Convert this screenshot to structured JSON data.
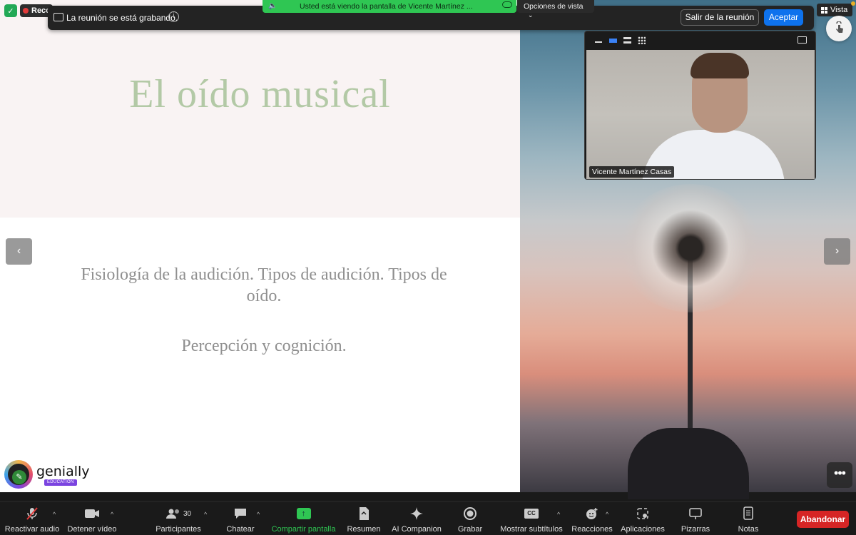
{
  "status": {
    "recording_label": "Recc",
    "recording_notice": "La reunión se está grabando.",
    "sharing_banner": "Usted está viendo la pantalla de Vicente Martínez ...",
    "view_options": "Opciones de vista",
    "leave_button": "Salir de la reunión",
    "accept_button": "Aceptar",
    "view_button": "Vista"
  },
  "slide": {
    "title": "El oído musical",
    "subtitle_1": "Fisiología de la audición. Tipos de audición. Tipos de oído.",
    "subtitle_2": "Percepción y cognición.",
    "brand": "genially",
    "brand_tag": "EDUCATION"
  },
  "video": {
    "participant_name": "Vicente Martínez Casas"
  },
  "toolbar": {
    "items": [
      {
        "label": "Reactivar audio",
        "icon": "mic-muted-icon"
      },
      {
        "label": "Detener vídeo",
        "icon": "video-camera-icon"
      },
      {
        "label": "Participantes",
        "icon": "participants-icon",
        "count": "30"
      },
      {
        "label": "Chatear",
        "icon": "chat-icon"
      },
      {
        "label": "Compartir pantalla",
        "icon": "share-screen-icon"
      },
      {
        "label": "Resumen",
        "icon": "summary-icon"
      },
      {
        "label": "AI Companion",
        "icon": "sparkle-icon"
      },
      {
        "label": "Grabar",
        "icon": "record-icon"
      },
      {
        "label": "Mostrar subtítulos",
        "icon": "captions-icon"
      },
      {
        "label": "Reacciones",
        "icon": "reactions-icon"
      },
      {
        "label": "Aplicaciones",
        "icon": "apps-icon"
      },
      {
        "label": "Pizarras",
        "icon": "whiteboard-icon"
      },
      {
        "label": "Notas",
        "icon": "notes-icon"
      }
    ],
    "end_button": "Abandonar"
  },
  "colors": {
    "share_green": "#2fc653",
    "accept_blue": "#0e72ed",
    "leave_red": "#d62525",
    "title_green": "#b3c9a6"
  }
}
